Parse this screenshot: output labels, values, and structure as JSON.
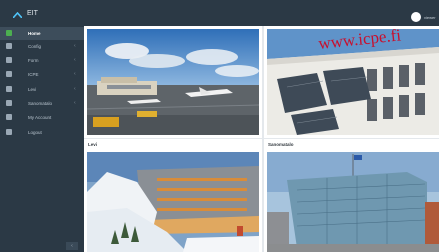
{
  "app": {
    "title": "EIT",
    "username": "viewer"
  },
  "sidebar": {
    "items": [
      {
        "label": "Home",
        "has_children": false
      },
      {
        "label": "Config",
        "has_children": true
      },
      {
        "label": "Form",
        "has_children": true
      },
      {
        "label": "ICPE",
        "has_children": true
      },
      {
        "label": "Levi",
        "has_children": true
      },
      {
        "label": "Sanomatalo",
        "has_children": true
      },
      {
        "label": "My Account",
        "has_children": false
      },
      {
        "label": "Logout",
        "has_children": false
      }
    ],
    "active_index": 0,
    "collapse_icon": "chevron-left-icon"
  },
  "cards": [
    {
      "title": "",
      "image": "airport"
    },
    {
      "title": "",
      "image": "icpe building"
    },
    {
      "title": "Levi",
      "image": "levi hotel"
    },
    {
      "title": "Sanomatalo",
      "image": "sanomatalo building"
    }
  ],
  "icpe_sign": "www.icpe.fi",
  "colors": {
    "sidebar_bg": "#2b3945",
    "active_bg": "#3d4d5b",
    "active_accent": "#4caf50",
    "content_bg": "#e4e8ec"
  }
}
